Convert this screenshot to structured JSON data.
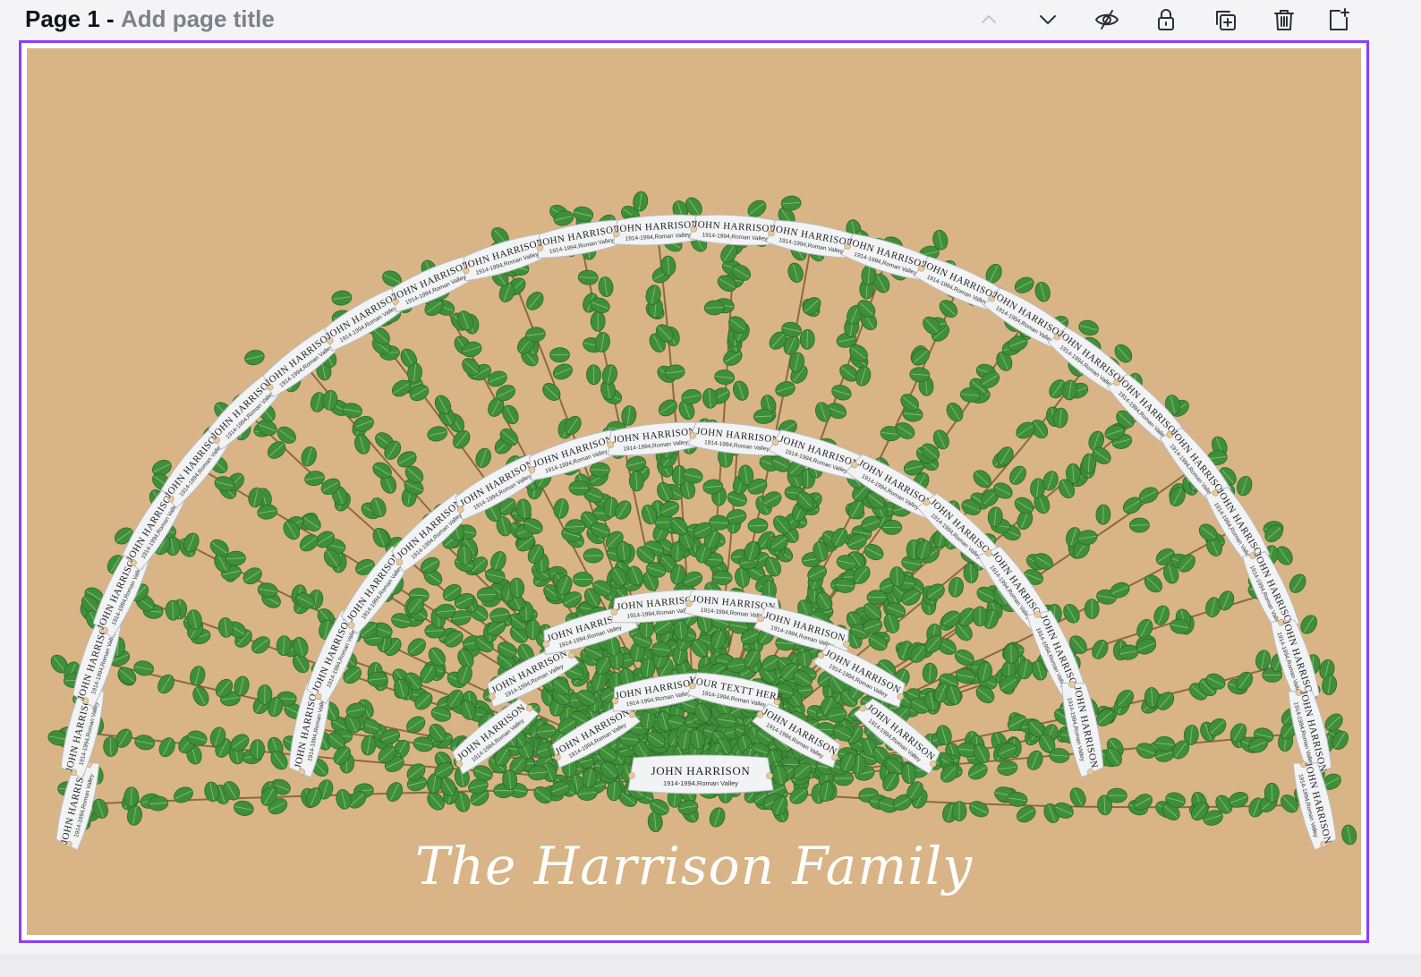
{
  "header": {
    "page_number_label": "Page 1 -",
    "page_title_placeholder": "Add page title"
  },
  "toolbar": {
    "items": [
      {
        "name": "move-page-up-button",
        "icon": "chevron-up-icon",
        "enabled": false
      },
      {
        "name": "move-page-down-button",
        "icon": "chevron-down-icon",
        "enabled": true
      },
      {
        "name": "hide-page-button",
        "icon": "eye-slash-icon",
        "enabled": true
      },
      {
        "name": "lock-page-button",
        "icon": "lock-icon",
        "enabled": true
      },
      {
        "name": "duplicate-page-button",
        "icon": "duplicate-icon",
        "enabled": true
      },
      {
        "name": "delete-page-button",
        "icon": "trash-icon",
        "enabled": true
      },
      {
        "name": "add-page-button",
        "icon": "add-page-icon",
        "enabled": true
      }
    ]
  },
  "design": {
    "background_color": "#d9b486",
    "accent_color": "#8b3dff",
    "title": "The Harrison Family",
    "root": {
      "name": "JOHN HARRISON",
      "dates": "1914-1994,Roman Valley"
    },
    "center_banner": {
      "name": "YOUR TEXTT HERE",
      "dates": "1914-1994,Roman Valley"
    },
    "member_name": "JOHN HARRISON",
    "member_dates": "1914-1994,Roman Valley",
    "leaf_color": "#3f8f3a",
    "branch_color": "#8a6b3f"
  }
}
